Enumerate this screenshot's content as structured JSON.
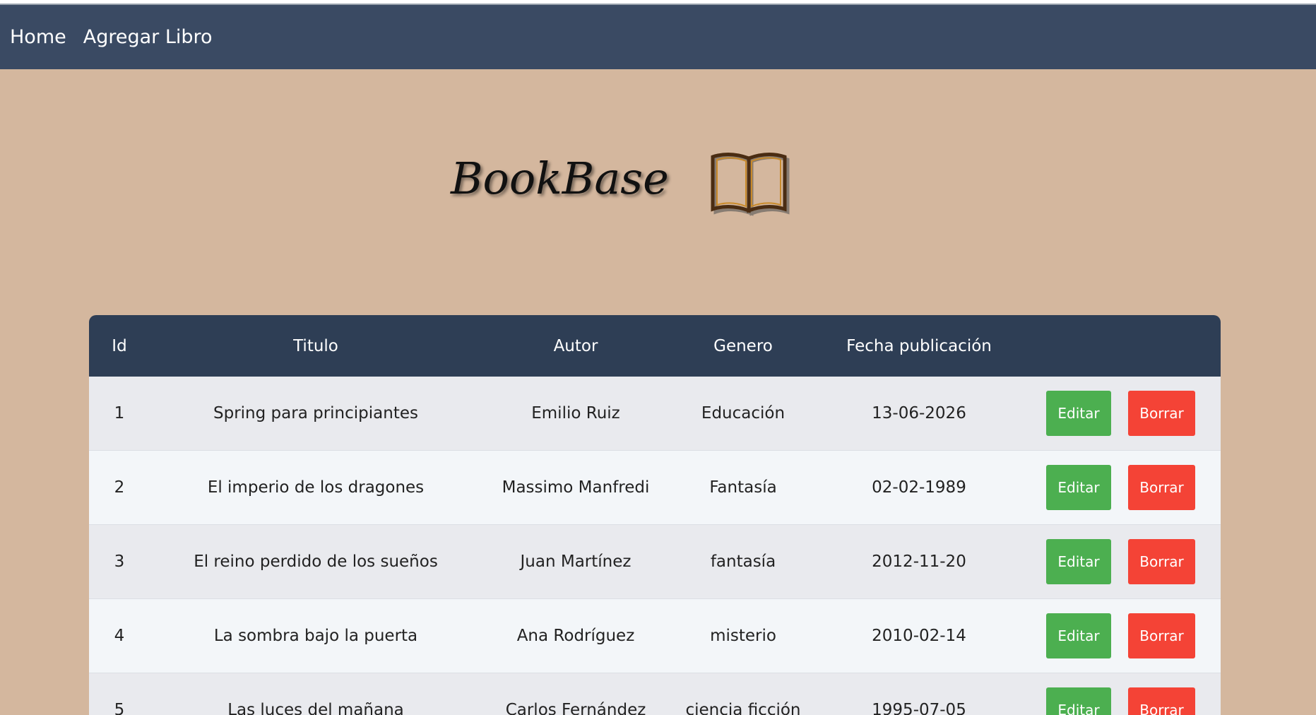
{
  "nav": {
    "home": "Home",
    "add_book": "Agregar Libro"
  },
  "brand": {
    "title": "BookBase",
    "icon": "open-book-icon"
  },
  "table": {
    "headers": [
      "Id",
      "Titulo",
      "Autor",
      "Genero",
      "Fecha publicación",
      ""
    ],
    "rows": [
      {
        "id": "1",
        "title": "Spring para principiantes",
        "author": "Emilio Ruiz",
        "genre": "Educación",
        "date": "13-06-2026",
        "edit": "Editar",
        "delete": "Borrar"
      },
      {
        "id": "2",
        "title": "El imperio de los dragones",
        "author": "Massimo Manfredi",
        "genre": "Fantasía",
        "date": "02-02-1989",
        "edit": "Editar",
        "delete": "Borrar"
      },
      {
        "id": "3",
        "title": "El reino perdido de los sueños",
        "author": "Juan Martínez",
        "genre": "fantasía",
        "date": "2012-11-20",
        "edit": "Editar",
        "delete": "Borrar"
      },
      {
        "id": "4",
        "title": "La sombra bajo la puerta",
        "author": "Ana Rodríguez",
        "genre": "misterio",
        "date": "2010-02-14",
        "edit": "Editar",
        "delete": "Borrar"
      },
      {
        "id": "5",
        "title": "Las luces del mañana",
        "author": "Carlos Fernández",
        "genre": "ciencia ficción",
        "date": "1995-07-05",
        "edit": "Editar",
        "delete": "Borrar"
      }
    ]
  },
  "colors": {
    "page_bg": "#d4b79e",
    "navbar_bg": "#3a4a63",
    "table_header_bg": "#2e3e55",
    "edit_button": "#4caf50",
    "delete_button": "#f44336"
  }
}
